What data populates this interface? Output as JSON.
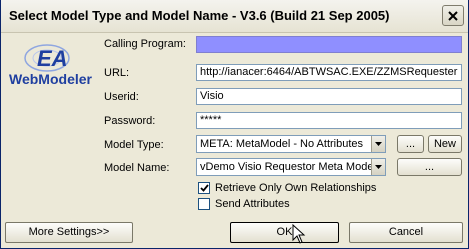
{
  "window": {
    "title": "Select Model Type and Model Name - V3.6 (Build 21 Sep 2005)"
  },
  "logo": {
    "text_top": "EA",
    "text_bottom": "WebModeler"
  },
  "form": {
    "calling_program_label": "Calling Program:",
    "calling_program_value": "",
    "url_label": "URL:",
    "url_value": "http://ianacer:6464/ABTWSAC.EXE/ZZMSRequester",
    "userid_label": "Userid:",
    "userid_value": "Visio",
    "password_label": "Password:",
    "password_value": "*****",
    "model_type_label": "Model Type:",
    "model_type_value": "META: MetaModel - No Attributes",
    "model_name_label": "Model Name:",
    "model_name_value": "vDemo Visio Requestor Meta Model",
    "browse_type_label": "...",
    "new_label": "New",
    "browse_name_label": "...",
    "retrieve_own_label": "Retrieve Only Own Relationships",
    "retrieve_own_checked": true,
    "send_attributes_label": "Send Attributes",
    "send_attributes_checked": false
  },
  "footer": {
    "more_settings_label": "More Settings>>",
    "ok_label": "OK",
    "cancel_label": "Cancel"
  },
  "colors": {
    "calling_program_field": "#8f8fff",
    "logo_blue": "#1f3fa0"
  }
}
